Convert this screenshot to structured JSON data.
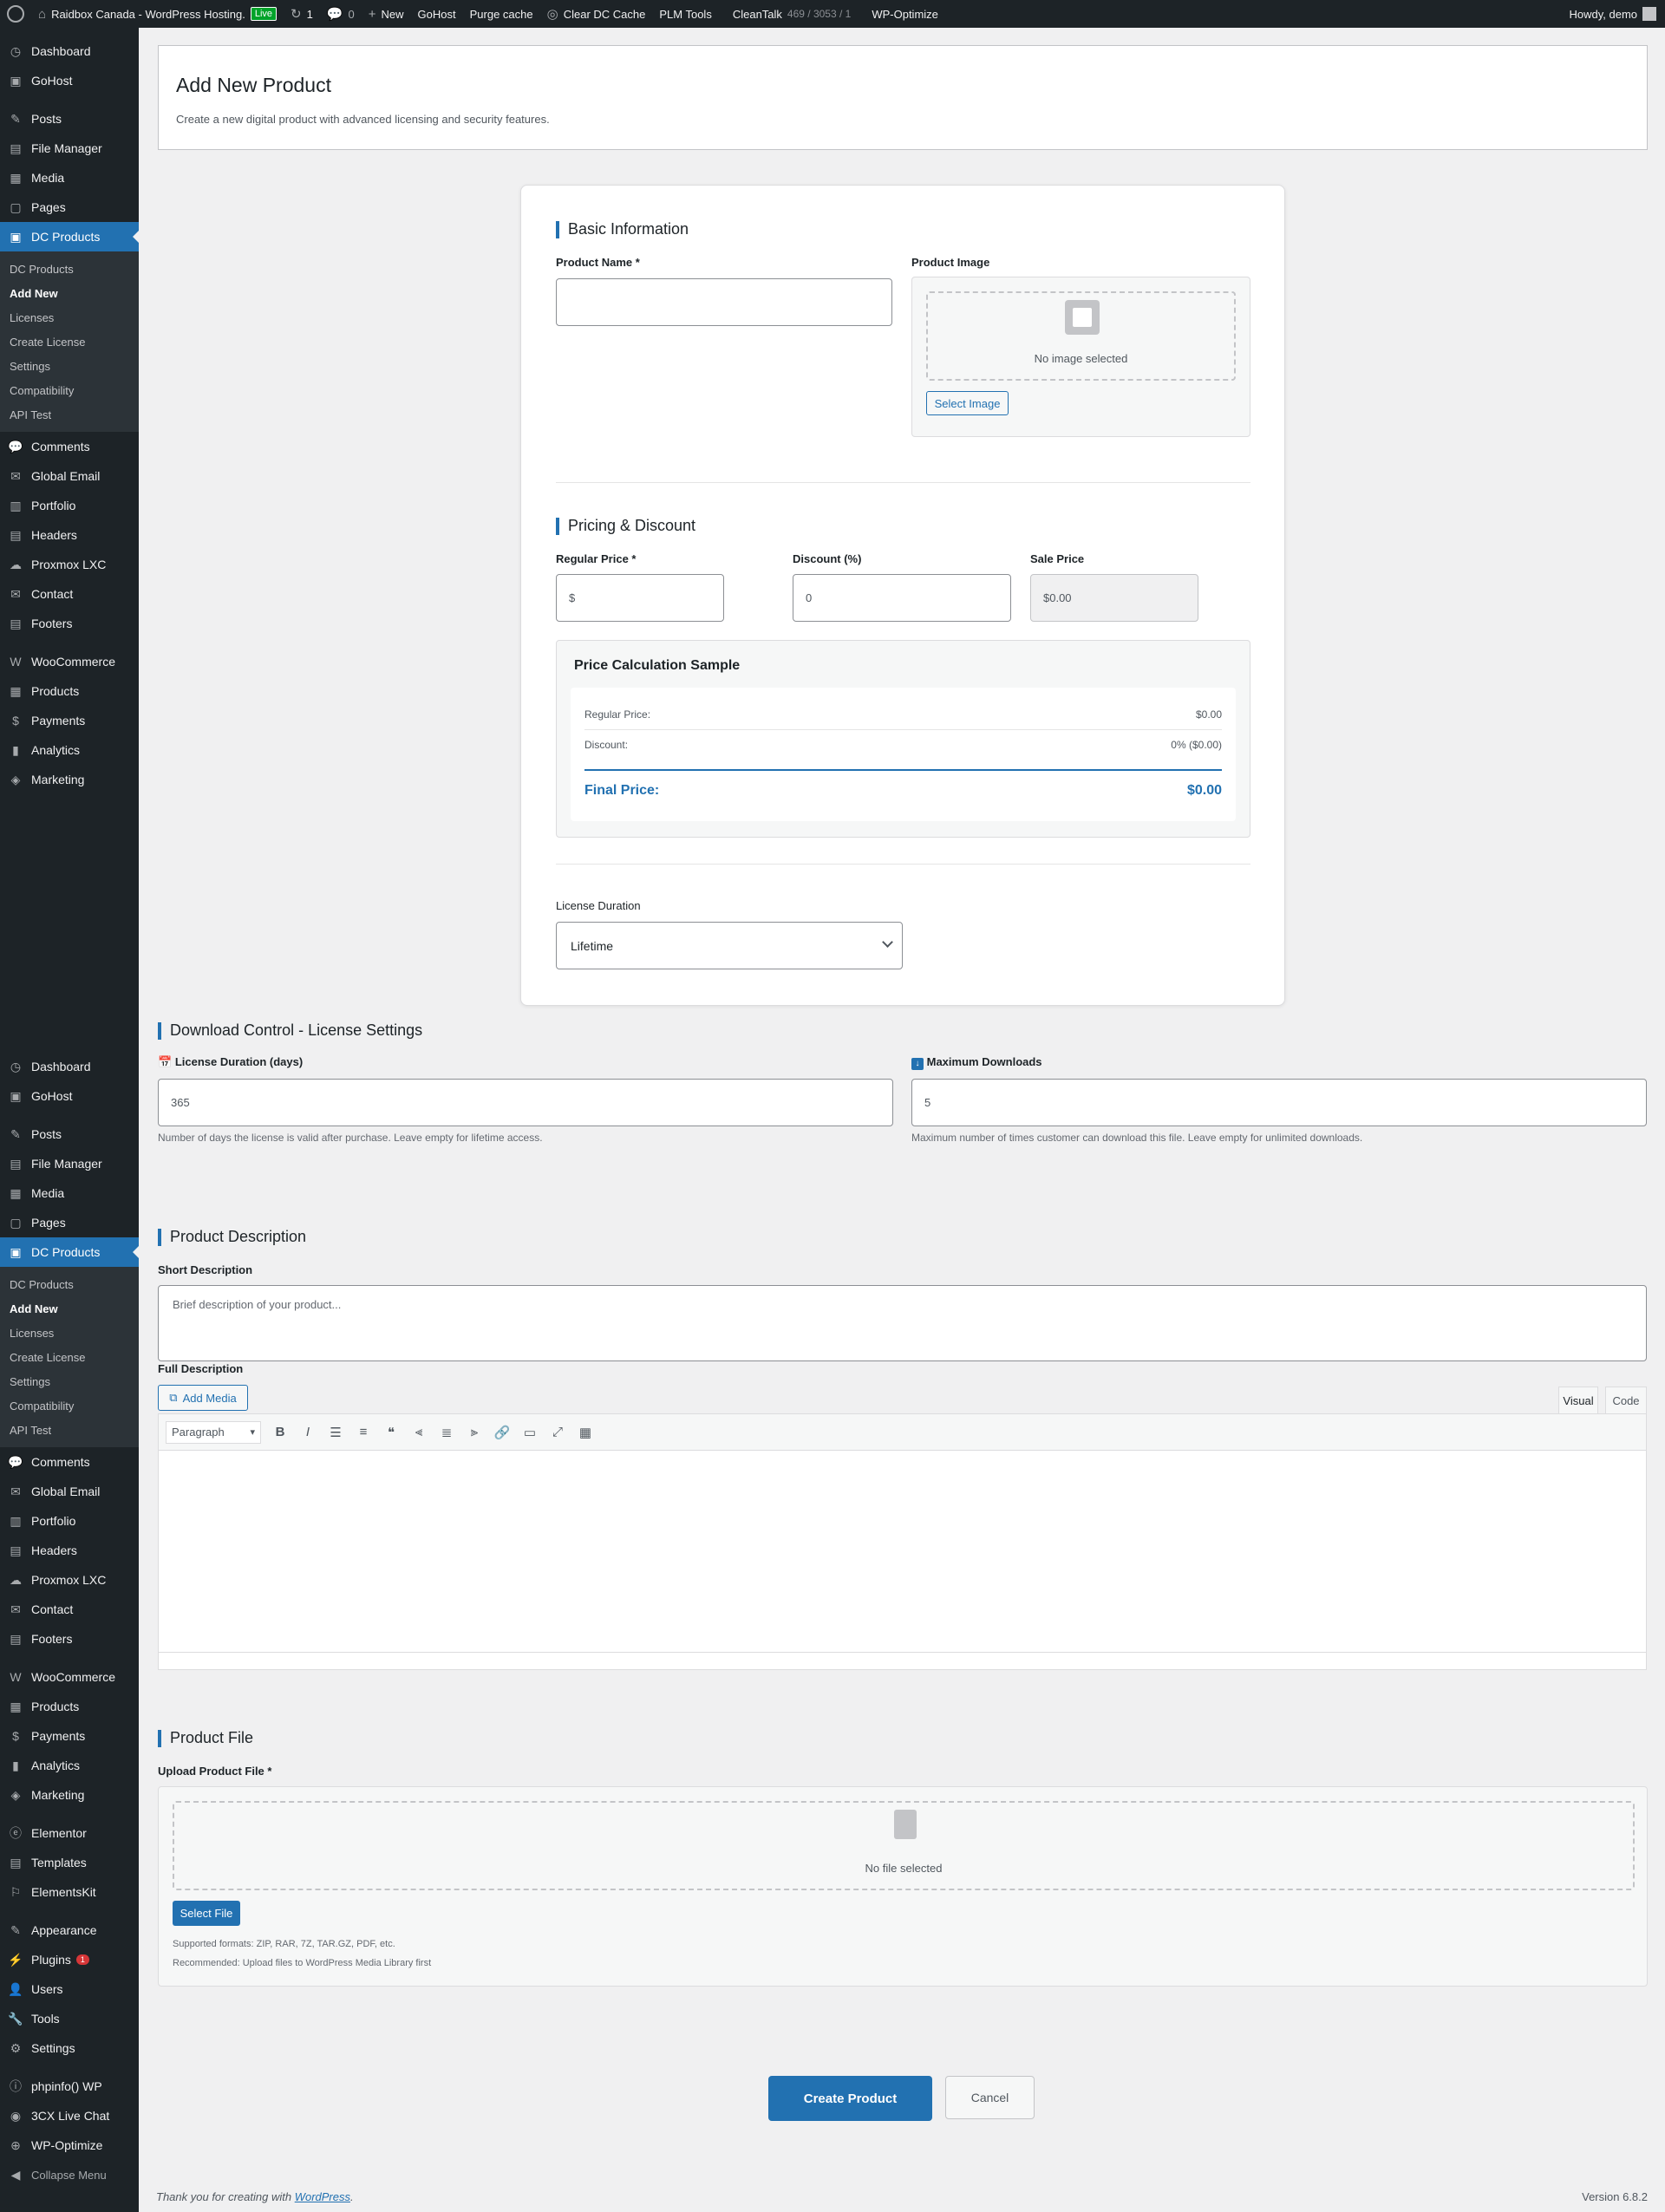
{
  "adminbar": {
    "site_name": "Raidbox Canada - WordPress Hosting.",
    "live": "Live",
    "updates": "1",
    "comments": "0",
    "new": "New",
    "gohost": "GoHost",
    "purge": "Purge cache",
    "clear_dc": "Clear DC Cache",
    "plm": "PLM Tools",
    "cleantalk": "CleanTalk",
    "cleantalk_stats": "469 / 3053 / 1",
    "wpopt": "WP-Optimize",
    "howdy": "Howdy, demo"
  },
  "sidebar": {
    "group1": [
      "Dashboard",
      "GoHost"
    ],
    "group2": [
      "Posts",
      "File Manager",
      "Media",
      "Pages",
      "DC Products"
    ],
    "submenu": [
      "DC Products",
      "Add New",
      "Licenses",
      "Create License",
      "Settings",
      "Compatibility",
      "API Test"
    ],
    "group3": [
      "Comments",
      "Global Email",
      "Portfolio",
      "Headers",
      "Proxmox LXC",
      "Contact",
      "Footers"
    ],
    "group4": [
      "WooCommerce",
      "Products",
      "Payments",
      "Analytics",
      "Marketing"
    ],
    "group5": [
      "Elementor",
      "Templates",
      "ElementsKit"
    ],
    "group6": [
      "Appearance",
      "Plugins",
      "Users",
      "Tools",
      "Settings"
    ],
    "plugins_badge": "1",
    "group7": [
      "phpinfo() WP",
      "3CX Live Chat",
      "WP-Optimize"
    ],
    "collapse": "Collapse Menu"
  },
  "header": {
    "title": "Add New Product",
    "subtitle": "Create a new digital product with advanced licensing and security features."
  },
  "basic": {
    "title": "Basic Information",
    "name_label": "Product Name *",
    "name_value": "",
    "image_label": "Product Image",
    "no_image": "No image selected",
    "select_image": "Select Image"
  },
  "pricing": {
    "title": "Pricing & Discount",
    "regular_label": "Regular Price *",
    "regular_prefix": "$",
    "discount_label": "Discount (%)",
    "discount_value": "0",
    "sale_label": "Sale Price",
    "sale_value": "$0.00",
    "calc_title": "Price Calculation Sample",
    "calc_regular_label": "Regular Price:",
    "calc_regular_value": "$0.00",
    "calc_discount_label": "Discount:",
    "calc_discount_value": "0% ($0.00)",
    "calc_final_label": "Final Price:",
    "calc_final_value": "$0.00"
  },
  "license": {
    "duration_label": "License Duration",
    "duration_value": "Lifetime"
  },
  "download": {
    "title": "Download Control - License Settings",
    "days_label": "License Duration (days)",
    "days_value": "365",
    "days_help": "Number of days the license is valid after purchase. Leave empty for lifetime access.",
    "max_label": "Maximum Downloads",
    "max_value": "5",
    "max_help": "Maximum number of times customer can download this file. Leave empty for unlimited downloads."
  },
  "description": {
    "title": "Product Description",
    "short_label": "Short Description",
    "short_placeholder": "Brief description of your product...",
    "full_label": "Full Description",
    "add_media": "Add Media",
    "tab_visual": "Visual",
    "tab_code": "Code",
    "paragraph": "Paragraph"
  },
  "file": {
    "title": "Product File",
    "upload_label": "Upload Product File *",
    "no_file": "No file selected",
    "select_file": "Select File",
    "formats": "Supported formats: ZIP, RAR, 7Z, TAR.GZ, PDF, etc.",
    "recommend": "Recommended: Upload files to WordPress Media Library first"
  },
  "actions": {
    "create": "Create Product",
    "cancel": "Cancel"
  },
  "footer": {
    "thanks": "Thank you for creating with ",
    "wp_link": "WordPress",
    "period": ".",
    "version": "Version 6.8.2"
  },
  "colors": {
    "accent": "#2271b1",
    "sidebar_bg": "#1d2327",
    "live_badge": "#00a32a"
  }
}
